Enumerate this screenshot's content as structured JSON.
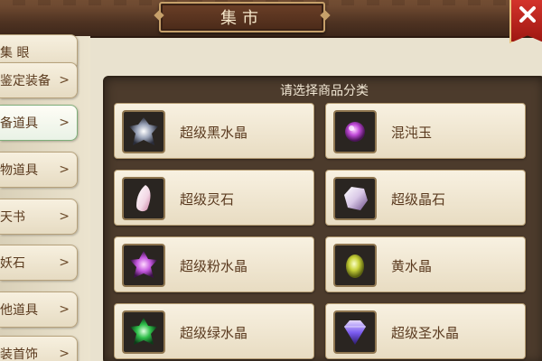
{
  "header": {
    "title": "集市"
  },
  "sidebar": {
    "items": [
      {
        "label": "集 眼"
      },
      {
        "label": "鉴定装备"
      },
      {
        "label": "备道具"
      },
      {
        "label": "物道具"
      },
      {
        "label": "天书"
      },
      {
        "label": "妖石"
      },
      {
        "label": "他道具"
      },
      {
        "label": "装首饰"
      }
    ],
    "active_index": 2
  },
  "panel": {
    "title": "请选择商品分类",
    "items": [
      {
        "name": "超级黑水晶",
        "icon": "black-crystal-icon"
      },
      {
        "name": "混沌玉",
        "icon": "chaos-jade-icon"
      },
      {
        "name": "超级灵石",
        "icon": "spirit-stone-icon"
      },
      {
        "name": "超级晶石",
        "icon": "crystal-stone-icon"
      },
      {
        "name": "超级粉水晶",
        "icon": "pink-crystal-icon"
      },
      {
        "name": "黄水晶",
        "icon": "yellow-crystal-icon"
      },
      {
        "name": "超级绿水晶",
        "icon": "green-crystal-icon"
      },
      {
        "name": "超级圣水晶",
        "icon": "holy-crystal-icon"
      }
    ]
  },
  "colors": {
    "close_red": "#c3241c",
    "panel_brown": "#4c3b2c",
    "card_bg": "#f3ead6"
  }
}
